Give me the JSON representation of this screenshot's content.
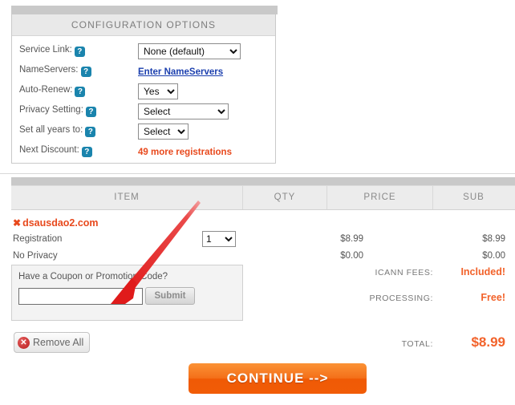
{
  "config": {
    "header": "CONFIGURATION OPTIONS",
    "help_icon_glyph": "?",
    "rows": [
      {
        "label": "Service Link:",
        "control": "select",
        "value": "None (default)"
      },
      {
        "label": "NameServers:",
        "control": "link",
        "value": "Enter NameServers"
      },
      {
        "label": "Auto-Renew:",
        "control": "select",
        "value": "Yes"
      },
      {
        "label": "Privacy Setting:",
        "control": "select",
        "value": "Select"
      },
      {
        "label": "Set all years to:",
        "control": "select",
        "value": "Select"
      },
      {
        "label": "Next Discount:",
        "control": "text",
        "value": "49 more registrations"
      }
    ]
  },
  "cart": {
    "columns": {
      "item": "ITEM",
      "qty": "QTY",
      "price": "PRICE",
      "sub": "SUB"
    },
    "domain": {
      "remove_glyph": "✖",
      "name": "dsausdao2.com"
    },
    "lines": [
      {
        "name": "Registration",
        "qty": "1",
        "price": "$8.99",
        "sub": "$8.99"
      },
      {
        "name": "No Privacy",
        "qty": "",
        "price": "$0.00",
        "sub": "$0.00"
      }
    ]
  },
  "coupon": {
    "title": "Have a Coupon or Promotion Code?",
    "input_value": "",
    "input_placeholder": "",
    "submit_label": "Submit"
  },
  "remove_all": {
    "label": "Remove All",
    "icon_glyph": "✕"
  },
  "fees": [
    {
      "label": "ICANN FEES:",
      "value": "Included!"
    },
    {
      "label": "PROCESSING:",
      "value": "Free!"
    }
  ],
  "total": {
    "label": "TOTAL:",
    "value": "$8.99"
  },
  "continue_button": {
    "label": "CONTINUE -->"
  },
  "colors": {
    "accent_orange": "#f2622a",
    "link_blue": "#1b3fae",
    "help_blue": "#1a84ad",
    "annotation_red": "#e8232a",
    "panel_gray": "#c9c9c9"
  }
}
